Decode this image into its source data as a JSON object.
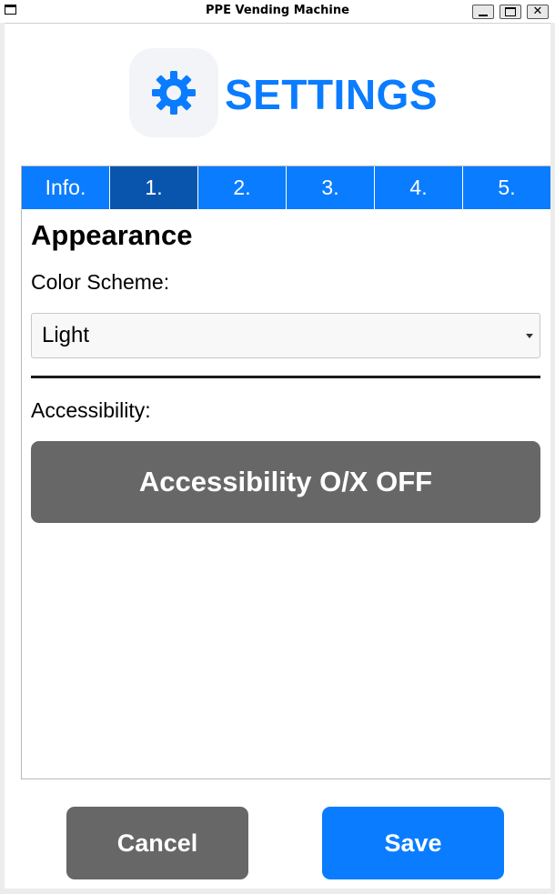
{
  "window": {
    "title": "PPE Vending Machine",
    "controls": {
      "minimize_icon": "minimize-icon",
      "maximize_icon": "maximize-icon",
      "close_label": "✕"
    }
  },
  "header": {
    "icon": "gear-icon",
    "title": "SETTINGS"
  },
  "tabs": [
    {
      "label": "Info.",
      "active": false
    },
    {
      "label": "1.",
      "active": true
    },
    {
      "label": "2.",
      "active": false
    },
    {
      "label": "3.",
      "active": false
    },
    {
      "label": "4.",
      "active": false
    },
    {
      "label": "5.",
      "active": false
    }
  ],
  "section": {
    "title": "Appearance",
    "color_scheme_label": "Color Scheme:",
    "color_scheme_value": "Light",
    "accessibility_label": "Accessibility:",
    "accessibility_button": "Accessibility O/X OFF"
  },
  "footer": {
    "cancel_label": "Cancel",
    "save_label": "Save"
  },
  "colors": {
    "accent": "#0a7cff",
    "tab_active": "#0955ae",
    "neutral_button": "#676767"
  }
}
